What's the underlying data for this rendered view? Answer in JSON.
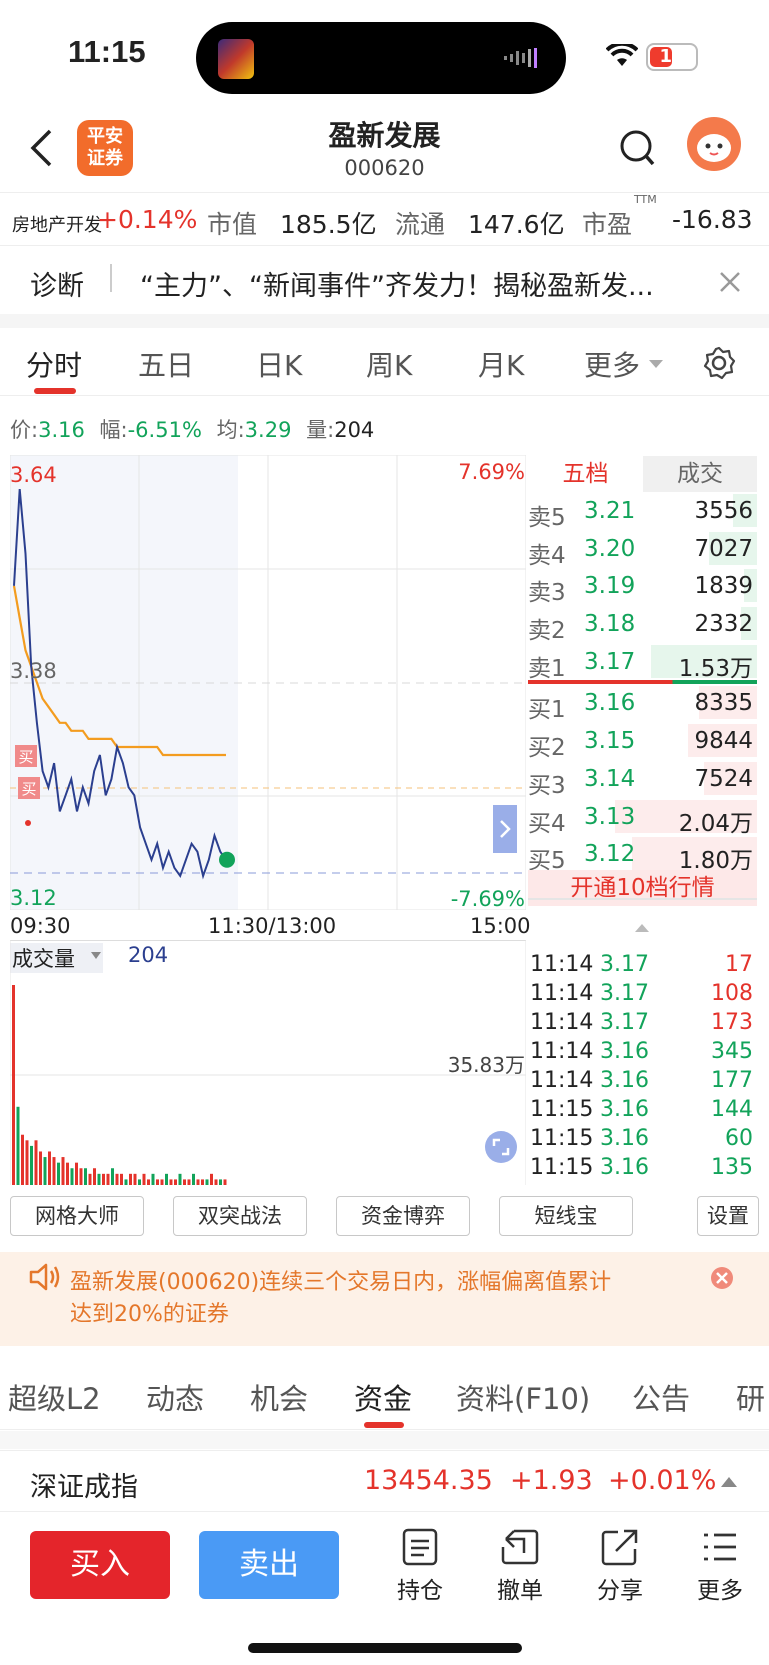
{
  "status": {
    "time": "11:15",
    "battery": "18"
  },
  "header": {
    "title": "盈新发展",
    "code": "000620",
    "logo_line1": "平安",
    "logo_line2": "证券"
  },
  "infobar": {
    "sector": "房地产开发",
    "sector_change": "+0.14%",
    "mktcap_label": "市值",
    "mktcap": "185.5亿",
    "float_label": "流通",
    "float": "147.6亿",
    "pe_label": "市盈",
    "pe_sup": "TTM",
    "pe": "-16.83"
  },
  "diagnosis": {
    "label": "诊断",
    "text": "“主力”、“新闻事件”齐发力！揭秘盈新发..."
  },
  "chart_tabs": [
    "分时",
    "五日",
    "日K",
    "周K",
    "月K",
    "更多"
  ],
  "price_row": {
    "price_label": "价:",
    "price": "3.16",
    "change_label": "幅:",
    "change": "-6.51%",
    "avg_label": "均:",
    "avg": "3.29",
    "vol_label": "量:",
    "vol": "204"
  },
  "chart_labels": {
    "high": "3.64",
    "high_pct": "7.69%",
    "mid": "3.38",
    "low": "3.12",
    "low_pct": "-7.69%",
    "t_start": "09:30",
    "t_mid": "11:30/13:00",
    "t_end": "15:00",
    "buy_mark": "买"
  },
  "volume": {
    "label": "成交量",
    "value": "204",
    "max": "35.83万"
  },
  "chart_data": [
    {
      "type": "line",
      "title": "",
      "ylim": [
        3.12,
        3.64
      ],
      "series": [
        {
          "values": [
            3.5,
            3.62,
            3.54,
            3.4,
            3.33,
            3.27,
            3.25,
            3.28,
            3.22,
            3.24,
            3.26,
            3.22,
            3.25,
            3.23,
            3.27,
            3.29,
            3.24,
            3.26,
            3.3,
            3.28,
            3.25,
            3.24,
            3.2,
            3.18,
            3.16,
            3.18,
            3.15,
            3.17,
            3.15,
            3.14,
            3.16,
            3.18,
            3.17,
            3.14,
            3.16,
            3.19,
            3.17,
            3.16
          ]
        },
        {
          "values": [
            3.5,
            3.46,
            3.42,
            3.4,
            3.38,
            3.36,
            3.35,
            3.34,
            3.33,
            3.33,
            3.32,
            3.32,
            3.32,
            3.31,
            3.31,
            3.31,
            3.31,
            3.31,
            3.3,
            3.3,
            3.3,
            3.3,
            3.3,
            3.3,
            3.3,
            3.3,
            3.29,
            3.29,
            3.29,
            3.29,
            3.29,
            3.29,
            3.29,
            3.29,
            3.29,
            3.29,
            3.29,
            3.29
          ]
        }
      ]
    },
    {
      "type": "bar",
      "title": "",
      "values": [
        35.8,
        14,
        9,
        8,
        7,
        8,
        6,
        5,
        6,
        5,
        4,
        5,
        4,
        3,
        4,
        3,
        3,
        2,
        3,
        2,
        2,
        2,
        3,
        2,
        2,
        1,
        2,
        2,
        1,
        2,
        1,
        2,
        1,
        1,
        2,
        1,
        1,
        2,
        1,
        1,
        2,
        1,
        1,
        1,
        2,
        1,
        1,
        1
      ]
    }
  ],
  "order_book": {
    "tab_active": "五档",
    "tab_other": "成交",
    "rows": [
      {
        "label": "卖5",
        "price": "3.21",
        "vol": "3556",
        "side": "sell",
        "bar": 0.15
      },
      {
        "label": "卖4",
        "price": "3.20",
        "vol": "7027",
        "side": "sell",
        "bar": 0.3
      },
      {
        "label": "卖3",
        "price": "3.19",
        "vol": "1839",
        "side": "sell",
        "bar": 0.08
      },
      {
        "label": "卖2",
        "price": "3.18",
        "vol": "2332",
        "side": "sell",
        "bar": 0.1
      },
      {
        "label": "卖1",
        "price": "3.17",
        "vol": "1.53万",
        "side": "sell",
        "bar": 0.66
      },
      {
        "label": "买1",
        "price": "3.16",
        "vol": "8335",
        "side": "buy",
        "bar": 0.36
      },
      {
        "label": "买2",
        "price": "3.15",
        "vol": "9844",
        "side": "buy",
        "bar": 0.43
      },
      {
        "label": "买3",
        "price": "3.14",
        "vol": "7524",
        "side": "buy",
        "bar": 0.33
      },
      {
        "label": "买4",
        "price": "3.13",
        "vol": "2.04万",
        "side": "buy",
        "bar": 0.89
      },
      {
        "label": "买5",
        "price": "3.12",
        "vol": "1.80万",
        "side": "buy",
        "bar": 0.78
      }
    ],
    "open_l2": "开通10档行情"
  },
  "trades": [
    {
      "time": "11:14",
      "price": "3.17",
      "vol": "17",
      "dir": "up"
    },
    {
      "time": "11:14",
      "price": "3.17",
      "vol": "108",
      "dir": "up"
    },
    {
      "time": "11:14",
      "price": "3.17",
      "vol": "173",
      "dir": "up"
    },
    {
      "time": "11:14",
      "price": "3.16",
      "vol": "345",
      "dir": "down"
    },
    {
      "time": "11:14",
      "price": "3.16",
      "vol": "177",
      "dir": "down"
    },
    {
      "time": "11:15",
      "price": "3.16",
      "vol": "144",
      "dir": "down"
    },
    {
      "time": "11:15",
      "price": "3.16",
      "vol": "60",
      "dir": "down"
    },
    {
      "time": "11:15",
      "price": "3.16",
      "vol": "135",
      "dir": "down"
    }
  ],
  "tools": [
    "网格大师",
    "双突战法",
    "资金博弈",
    "短线宝",
    "设置"
  ],
  "notice": {
    "line1": "盈新发展(000620)连续三个交易日内，涨幅偏离值累计",
    "line2": "达到20%的证券"
  },
  "info_tabs": [
    "超级L2",
    "动态",
    "机会",
    "资金",
    "资料(F10)",
    "公告",
    "研"
  ],
  "index": {
    "name": "深证成指",
    "value": "13454.35",
    "change": "+1.93",
    "pct": "+0.01%"
  },
  "bottom": {
    "buy": "买入",
    "sell": "卖出",
    "nav": [
      "持仓",
      "撤单",
      "分享",
      "更多"
    ]
  },
  "colors": {
    "up": "#e4332b",
    "down": "#12a35a",
    "accent": "#f26c2b",
    "sell_btn": "#4a9af5"
  }
}
